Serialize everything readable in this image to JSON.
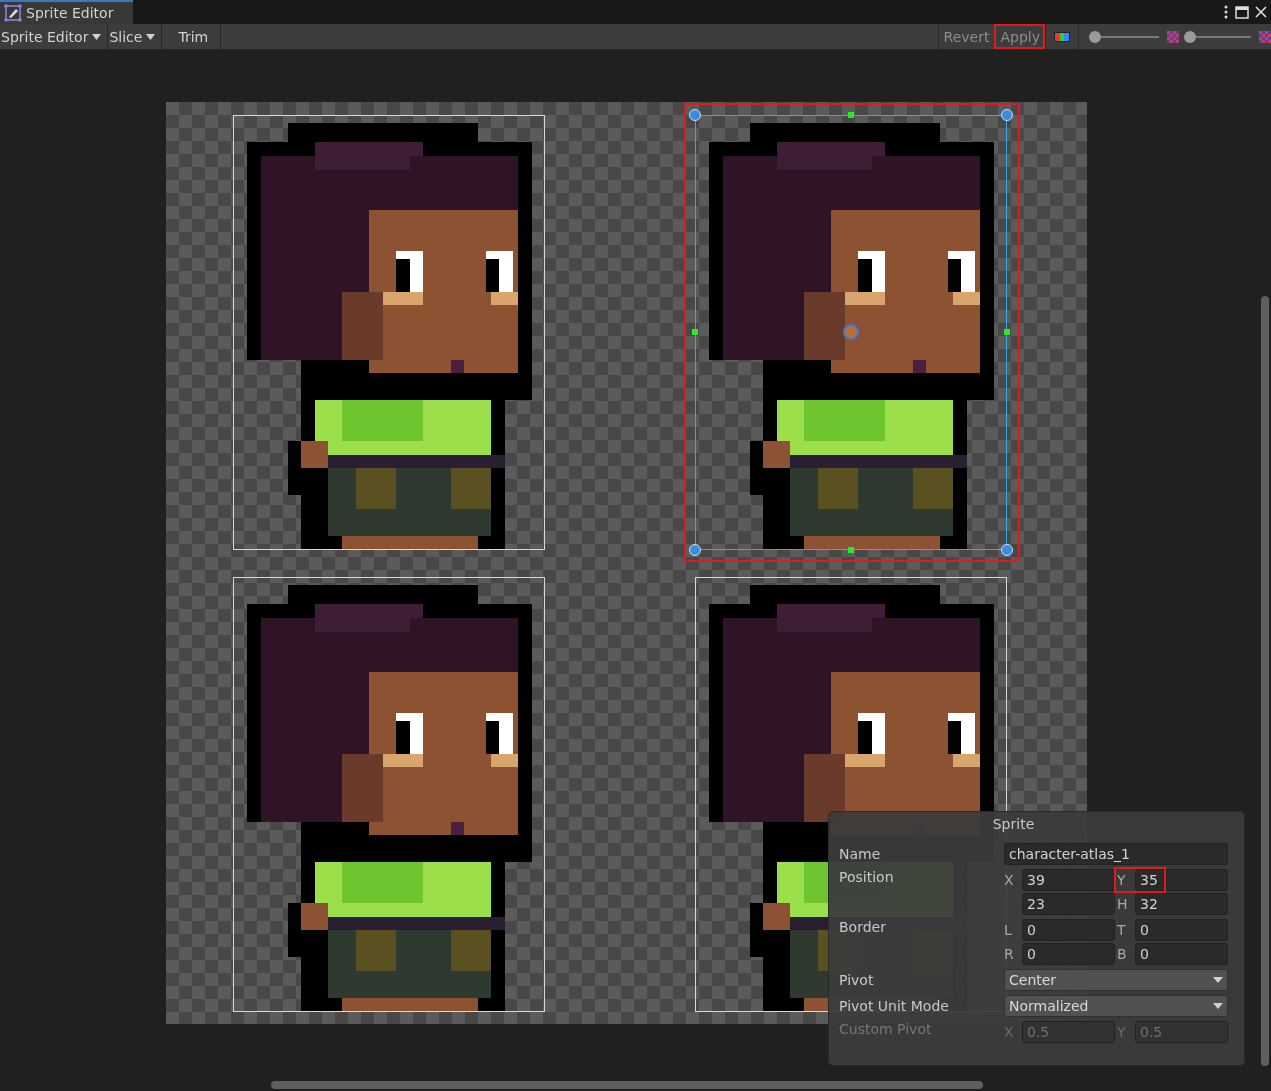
{
  "window": {
    "tab_title": "Sprite Editor"
  },
  "toolbar": {
    "menus": [
      {
        "label": "Sprite Editor",
        "kind": "dropdown"
      },
      {
        "label": "Slice",
        "kind": "dropdown"
      },
      {
        "label": "Trim",
        "kind": "button"
      }
    ],
    "actions": [
      {
        "label": "Revert",
        "highlighted": false
      },
      {
        "label": "Apply",
        "highlighted": true
      }
    ],
    "zoom_slider": {
      "level": 0.0
    },
    "mip_slider": {
      "level": 0.05
    }
  },
  "sprites": [
    {
      "selected": false
    },
    {
      "selected": true
    },
    {
      "selected": false
    },
    {
      "selected": false
    }
  ],
  "inspector": {
    "title": "Sprite",
    "rows": [
      {
        "label": "Name",
        "kind": "text",
        "value": "character-atlas_1",
        "disabled": false
      },
      {
        "label": "Position",
        "kind": "pairs",
        "disabled": false,
        "lines": [
          [
            {
              "axis": "X",
              "value": "39",
              "highlighted": false
            },
            {
              "axis": "Y",
              "value": "35",
              "highlighted": true
            }
          ],
          [
            {
              "value": "23",
              "highlighted": false
            },
            {
              "axis": "H",
              "value": "32",
              "highlighted": false
            }
          ]
        ]
      },
      {
        "label": "Border",
        "kind": "pairs",
        "disabled": false,
        "lines": [
          [
            {
              "axis": "L",
              "value": "0",
              "highlighted": false
            },
            {
              "axis": "T",
              "value": "0",
              "highlighted": false
            }
          ],
          [
            {
              "axis": "R",
              "value": "0",
              "highlighted": false
            },
            {
              "axis": "B",
              "value": "0",
              "highlighted": false
            }
          ]
        ]
      },
      {
        "label": "Pivot",
        "kind": "dropdown",
        "value": "Center",
        "disabled": false
      },
      {
        "label": "Pivot Unit Mode",
        "kind": "dropdown",
        "value": "Normalized",
        "disabled": false
      },
      {
        "label": "Custom Pivot",
        "kind": "pairs",
        "disabled": true,
        "lines": [
          [
            {
              "axis": "X",
              "value": "0.5",
              "highlighted": false
            },
            {
              "axis": "Y",
              "value": "0.5",
              "highlighted": false
            }
          ]
        ]
      }
    ]
  }
}
